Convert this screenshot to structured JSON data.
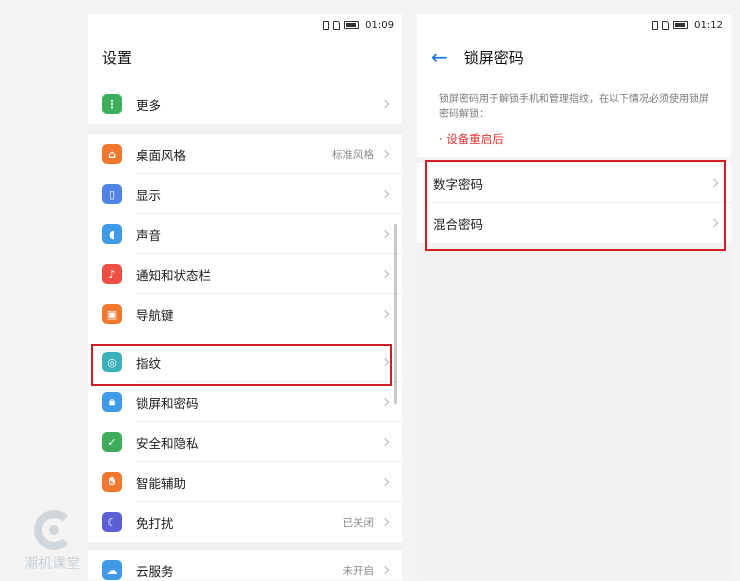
{
  "left": {
    "status": {
      "time": "01:09"
    },
    "title": "设置",
    "group_more": [
      {
        "label": "更多",
        "value": "",
        "icon": "more-dots-icon",
        "color": "#3fae5a"
      }
    ],
    "group_main": [
      {
        "label": "桌面风格",
        "value": "标准风格",
        "icon": "home-icon",
        "color": "#f0772f"
      },
      {
        "label": "显示",
        "value": "",
        "icon": "phone-display-icon",
        "color": "#4f84e6"
      },
      {
        "label": "声音",
        "value": "",
        "icon": "speaker-icon",
        "color": "#3f9be8"
      },
      {
        "label": "通知和状态栏",
        "value": "",
        "icon": "bell-icon",
        "color": "#ee4f45"
      },
      {
        "label": "导航键",
        "value": "",
        "icon": "navigation-key-icon",
        "color": "#f0772f"
      },
      {
        "label": "指纹",
        "value": "",
        "icon": "fingerprint-icon",
        "color": "#3ab0b8"
      },
      {
        "label": "锁屏和密码",
        "value": "",
        "icon": "lock-icon",
        "color": "#3f9be8"
      },
      {
        "label": "安全和隐私",
        "value": "",
        "icon": "shield-check-icon",
        "color": "#3fae5a"
      },
      {
        "label": "智能辅助",
        "value": "",
        "icon": "hand-icon",
        "color": "#f0772f"
      },
      {
        "label": "免打扰",
        "value": "已关闭",
        "icon": "moon-icon",
        "color": "#5b5fd6"
      }
    ],
    "group_cloud": [
      {
        "label": "云服务",
        "value": "未开启",
        "icon": "cloud-icon",
        "color": "#3f9be8"
      }
    ]
  },
  "right": {
    "status": {
      "time": "01:12"
    },
    "title": "锁屏密码",
    "description": "锁屏密码用于解锁手机和管理指纹，在以下情况必须使用锁屏密码解锁：",
    "bullet": "· 设备重启后",
    "options": [
      {
        "label": "数字密码"
      },
      {
        "label": "混合密码"
      }
    ]
  },
  "watermark": {
    "text": "潮机课堂"
  },
  "colors": {
    "highlight": "#d01f24",
    "accent": "#1a73e8",
    "warning": "#e03131"
  }
}
